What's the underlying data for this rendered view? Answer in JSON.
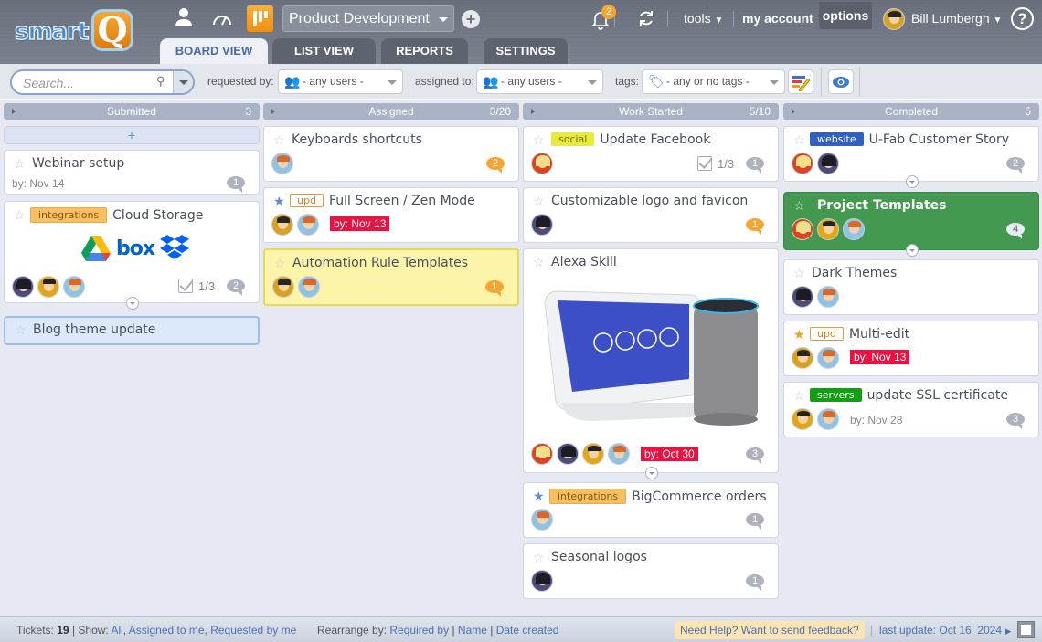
{
  "app": {
    "logo_text": "smart",
    "logo_letter": "Q"
  },
  "header": {
    "project_selected": "Product Development",
    "notifications_count": "2",
    "tools_label": "tools",
    "my_account_label": "my account",
    "options_label": "options",
    "user_name": "Bill Lumbergh",
    "help_label": "?"
  },
  "tabs": [
    {
      "label": "BOARD VIEW",
      "active": true
    },
    {
      "label": "LIST VIEW",
      "active": false
    },
    {
      "label": "REPORTS",
      "active": false
    },
    {
      "label": "SETTINGS",
      "active": false
    }
  ],
  "filters": {
    "search_placeholder": "Search...",
    "requested_by_label": "requested by:",
    "requested_by_value": "- any users -",
    "assigned_to_label": "assigned to:",
    "assigned_to_value": "- any users -",
    "tags_label": "tags:",
    "tags_value": "- any or no tags -"
  },
  "columns": [
    {
      "name": "Submitted",
      "count": "3",
      "add_label": "+",
      "cards": [
        {
          "title": "Webinar setup",
          "starred": false,
          "due": "by: Nov 14",
          "comments": "1"
        },
        {
          "title": "Cloud Storage",
          "tag": "integrations",
          "starred": false,
          "logos": [
            "google-drive",
            "box",
            "dropbox"
          ],
          "logo_box_text": "box",
          "assignees": [
            "dark",
            "geek",
            "ginger"
          ],
          "checklist": "1/3",
          "comments": "2"
        },
        {
          "title": "Blog theme update",
          "starred": false
        }
      ]
    },
    {
      "name": "Assigned",
      "count": "3/20",
      "cards": [
        {
          "title": "Keyboards shortcuts",
          "starred": false,
          "assignees": [
            "ginger"
          ],
          "comments": "2"
        },
        {
          "title": "Full Screen / Zen Mode",
          "tag": "upd",
          "starred": true,
          "assignees": [
            "boss",
            "ginger"
          ],
          "due": "by: Nov 13"
        },
        {
          "title": "Automation Rule Templates",
          "starred": false,
          "assignees": [
            "boss",
            "ginger"
          ],
          "comments": "1"
        }
      ]
    },
    {
      "name": "Work Started",
      "count": "5/10",
      "cards": [
        {
          "title": "Update Facebook",
          "tag": "social",
          "starred": false,
          "assignees": [
            "blond"
          ],
          "checklist": "1/3",
          "comments": "1"
        },
        {
          "title": "Customizable logo and favicon",
          "starred": false,
          "assignees": [
            "dark"
          ],
          "comments": "1"
        },
        {
          "title": "Alexa Skill",
          "starred": false,
          "image": "echo-show-and-echo",
          "assignees": [
            "blond",
            "dark",
            "geek",
            "ginger"
          ],
          "due": "by: Oct 30",
          "comments": "3"
        },
        {
          "title": "BigCommerce orders",
          "tag": "integrations",
          "starred": true,
          "assignees": [
            "ginger"
          ],
          "comments": "1"
        },
        {
          "title": "Seasonal logos",
          "starred": false,
          "assignees": [
            "dark"
          ],
          "comments": "1"
        }
      ]
    },
    {
      "name": "Completed",
      "count": "5",
      "cards": [
        {
          "title": "U-Fab Customer Story",
          "tag": "website",
          "starred": false,
          "assignees": [
            "blond",
            "dark"
          ],
          "comments": "2"
        },
        {
          "title": "Project Templates",
          "starred": false,
          "assignees": [
            "blond",
            "geek",
            "ginger"
          ],
          "comments": "4"
        },
        {
          "title": "Dark Themes",
          "starred": false,
          "assignees": [
            "dark",
            "ginger"
          ]
        },
        {
          "title": "Multi-edit",
          "tag": "upd",
          "starred": true,
          "assignees": [
            "boss",
            "ginger"
          ],
          "due": "by: Nov 13"
        },
        {
          "title": "update SSL certificate",
          "tag": "servers",
          "starred": false,
          "assignees": [
            "geek",
            "ginger"
          ],
          "due": "by: Nov 28",
          "comments": "3"
        }
      ]
    }
  ],
  "footer": {
    "tickets_label": "Tickets:",
    "tickets_count": "19",
    "show_label": "| Show:",
    "show_all": "All",
    "show_assigned": "Assigned to me",
    "show_requested": "Requested by me",
    "rearrange_label": "Rearrange by:",
    "rearrange_required": "Required by",
    "rearrange_name": "Name",
    "rearrange_date": "Date created",
    "feedback": "Need Help? Want to send feedback?",
    "last_update": "last update: Oct 16, 2024"
  },
  "colors": {
    "accent": "#f7a530",
    "header_bg": "#72788a",
    "completed_green": "#43994f",
    "highlight_yellow": "#fcf4a8",
    "due_red": "#ef1040"
  }
}
